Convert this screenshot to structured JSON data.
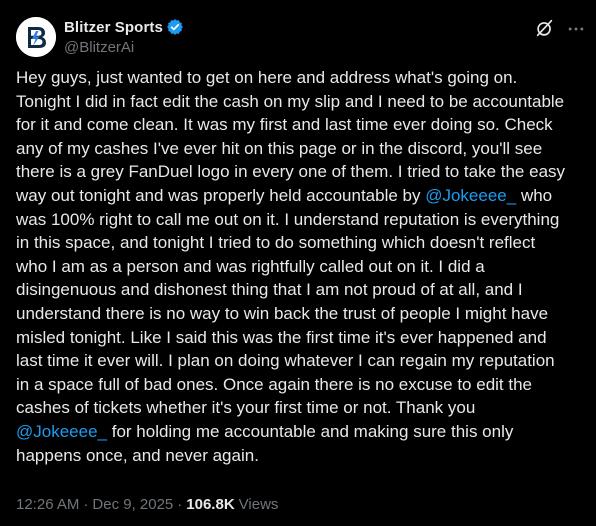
{
  "author": {
    "display_name": "Blitzer Sports",
    "handle": "@BlitzerAi",
    "verified": true,
    "avatar_icon": "blitzer-logo",
    "verified_color": "#1d9bf0"
  },
  "actions": {
    "grok_icon": "grok-icon",
    "more_icon": "more-horizontal-icon"
  },
  "tweet": {
    "lines": [
      {
        "text": "Hey guys, just wanted to get on here and address what's going on."
      },
      {
        "text": "Tonight I did in fact edit the cash on my slip and I need to be accountable"
      },
      {
        "text": "for it and come clean. It was my first and last time ever doing so. Check"
      },
      {
        "text": "any of my cashes I've ever hit on this page or in the discord, you'll see"
      },
      {
        "text": "there is a grey FanDuel logo in every one of them. I tried to take the easy"
      },
      {
        "text": "way out tonight and was properly held accountable by ",
        "mention": "@Jokeeee_",
        "after": " who"
      },
      {
        "text": "was 100% right to call me out on it. I understand reputation is everything"
      },
      {
        "text": "in this space, and tonight I tried to do something which doesn't reflect"
      },
      {
        "text": "who I am as a person and was rightfully called out on it. I did a"
      },
      {
        "text": "disingenuous and dishonest thing that I am not proud of at all, and I"
      },
      {
        "text": "understand there is no way to win back the trust of people I might have"
      },
      {
        "text": "misled tonight. Like I said this was the first time it's ever happened and"
      },
      {
        "text": "last time it ever will. I plan on doing whatever I can regain my reputation"
      },
      {
        "text": "in a space full of bad ones. Once again there is no excuse to edit the"
      },
      {
        "text": "cashes of tickets whether it's your first time or not. Thank you"
      },
      {
        "text": "",
        "mention": "@Jokeeee_",
        "after": " for holding me accountable and making sure this only"
      },
      {
        "text": "happens once, and never again."
      }
    ],
    "mention_color": "#1d9bf0"
  },
  "meta": {
    "time": "12:26 AM",
    "separator": "·",
    "date": "Dec 9, 2025",
    "views_count": "106.8K",
    "views_label": "Views"
  }
}
